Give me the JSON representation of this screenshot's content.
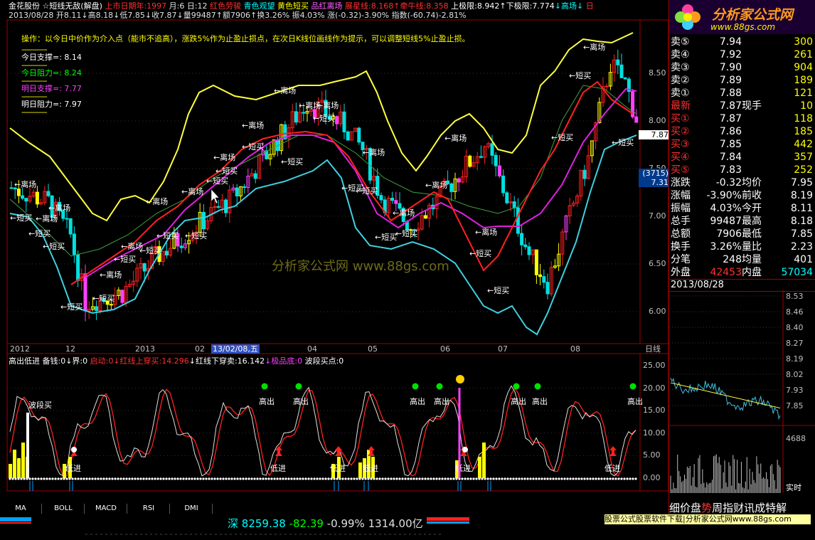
{
  "header": {
    "line1": [
      {
        "text": "金花股份",
        "color": "#ffffff"
      },
      {
        "text": " ☆短线无敌(解盘)",
        "color": "#ffffff"
      },
      {
        "text": " 上市日期年:1997",
        "color": "#ff3030"
      },
      {
        "text": " 月:6",
        "color": "#e0e0e0"
      },
      {
        "text": " 日:12",
        "color": "#e0e0e0"
      },
      {
        "text": " 红色劳骏",
        "color": "#ff3030"
      },
      {
        "text": " 青色观望",
        "color": "#00ffff"
      },
      {
        "text": " 黄色短买",
        "color": "#ffff00"
      },
      {
        "text": " 品红离场",
        "color": "#ff60ff"
      },
      {
        "text": " 展星线:8.168",
        "color": "#ff3030"
      },
      {
        "text": "↑牵牛线:8.358",
        "color": "#ff3030"
      },
      {
        "text": " 上极限:8.942",
        "color": "#ffffff"
      },
      {
        "text": "↑下极限:7.774",
        "color": "#ffffff"
      },
      {
        "text": "↓高场↓",
        "color": "#00ffff"
      },
      {
        "text": " 日",
        "color": "#ff3030"
      }
    ],
    "line2": [
      {
        "text": "2013/08/28",
        "color": "#e0e0e0"
      },
      {
        "text": " 开8.11↓",
        "color": "#e0e0e0"
      },
      {
        "text": "高8.18↓",
        "color": "#e0e0e0"
      },
      {
        "text": "低7.85↓",
        "color": "#e0e0e0"
      },
      {
        "text": "收7.87↓",
        "color": "#e0e0e0"
      },
      {
        "text": "量99487↑",
        "color": "#e0e0e0"
      },
      {
        "text": "额7906↑",
        "color": "#e0e0e0"
      },
      {
        "text": "换3.26%",
        "color": "#e0e0e0"
      },
      {
        "text": " 振4.03%",
        "color": "#e0e0e0"
      },
      {
        "text": " 涨(-0.32)-3.90%",
        "color": "#e0e0e0"
      },
      {
        "text": " 指数(-60.74)-2.81%",
        "color": "#e0e0e0"
      }
    ]
  },
  "tip": "操作：以今日中价作为介入点（能市不追高），涨跌5%作为止盈止损点，在次日K线位画线作为提示，可以调整短线5%止盈止损。",
  "support_resistance": [
    {
      "label": "今日支撑=:",
      "value": "8.14",
      "color": "#ffffff"
    },
    {
      "label": "今日阻力=:",
      "value": "8.24",
      "color": "#00ff00"
    },
    {
      "label": "明日支撑=:",
      "value": "7.77",
      "color": "#ff40ff"
    },
    {
      "label": "明日阻力=:",
      "value": "7.97",
      "color": "#ffffff"
    }
  ],
  "sr_dash": "------------",
  "price_axis": [
    "8.50",
    "8.00",
    "7.50",
    "7.00",
    "6.50",
    "6.00"
  ],
  "price_tags": {
    "current": "7.87",
    "code": "(3715)",
    "low": "7.31"
  },
  "watermark": "分析家公式网 www.88gs.com",
  "date_axis": [
    {
      "text": "2012"
    },
    {
      "text": "12"
    },
    {
      "text": "2013"
    },
    {
      "text": "02"
    },
    {
      "text": "13/02/08,五",
      "highlight": true
    },
    {
      "text": "04"
    },
    {
      "text": "05"
    },
    {
      "text": "06"
    },
    {
      "text": "07"
    },
    {
      "text": "08"
    },
    {
      "text": "日线"
    }
  ],
  "main_labels": {
    "leave": "离场",
    "buy": "短买"
  },
  "indicator": {
    "header": [
      {
        "text": "高出低进",
        "color": "#ffffff"
      },
      {
        "text": "  备钱:0",
        "color": "#ffffff"
      },
      {
        "text": "↓界:0",
        "color": "#ffffff"
      },
      {
        "text": "  启动:0",
        "color": "#ff3030"
      },
      {
        "text": "↓红线上穿买:14.296",
        "color": "#ff3030"
      },
      {
        "text": "↓红线下穿卖:16.142",
        "color": "#ffffff"
      },
      {
        "text": "↓极品底:0",
        "color": "#ff40ff"
      },
      {
        "text": "  波段买点:0",
        "color": "#ffffff"
      }
    ],
    "axis": [
      "25.00",
      "20.00",
      "15.00",
      "10.00",
      "5.00",
      "0.00"
    ],
    "labels": {
      "high_out": "高出",
      "low_in": "低进",
      "wave_buy": "波段买"
    }
  },
  "tabs": [
    "MA",
    "BOLL",
    "MACD",
    "RSI",
    "DMI"
  ],
  "quote": {
    "asks": [
      {
        "label": "卖⑤",
        "price": "7.94",
        "vol": "300"
      },
      {
        "label": "卖④",
        "price": "7.92",
        "vol": "261"
      },
      {
        "label": "卖③",
        "price": "7.90",
        "vol": "904"
      },
      {
        "label": "卖②",
        "price": "7.89",
        "vol": "189"
      },
      {
        "label": "卖①",
        "price": "7.88",
        "vol": "121"
      }
    ],
    "latest": {
      "label": "最新",
      "price": "7.87",
      "extra": "现手",
      "vol": "10"
    },
    "bids": [
      {
        "label": "买①",
        "price": "7.87",
        "vol": "118"
      },
      {
        "label": "买②",
        "price": "7.86",
        "vol": "185"
      },
      {
        "label": "买③",
        "price": "7.85",
        "vol": "442"
      },
      {
        "label": "买④",
        "price": "7.84",
        "vol": "357"
      },
      {
        "label": "买⑤",
        "price": "7.83",
        "vol": "252"
      }
    ],
    "stats": [
      {
        "l1": "涨跌",
        "v1": "-0.32",
        "l2": "均价",
        "v2": "7.95"
      },
      {
        "l1": "涨幅",
        "v1": "-3.90%",
        "l2": "前收",
        "v2": "8.19"
      },
      {
        "l1": "振幅",
        "v1": "4.03%",
        "l2": "今开",
        "v2": "8.11"
      },
      {
        "l1": "总手",
        "v1": "99487",
        "l2": "最高",
        "v2": "8.18"
      },
      {
        "l1": "总额",
        "v1": "7906",
        "l2": "最低",
        "v2": "7.85"
      },
      {
        "l1": "换手",
        "v1": "3.26%",
        "l2": "量比",
        "v2": "2.23"
      },
      {
        "l1": "分笔",
        "v1": "248",
        "l2": "均量",
        "v2": "401"
      }
    ],
    "outer": {
      "l1": "外盘",
      "v1": "42453",
      "l2": "内盘",
      "v2": "57034"
    }
  },
  "intraday": {
    "date": "2013/08/28",
    "axis": [
      "8.53",
      "8.46",
      "8.40",
      "8.27",
      "8.19",
      "8.02",
      "7.93",
      "7.85"
    ],
    "vol_label": "4688",
    "realtime": "实时"
  },
  "logo": {
    "title": "分析家公式网",
    "url": "www.88gs.com"
  },
  "right_tabs": [
    "细",
    "价",
    "盘",
    "势",
    "周",
    "指",
    "财",
    "讯",
    "成",
    "特",
    "解"
  ],
  "index_bar": {
    "name": "深",
    "value": "8259.38",
    "change": "-82.39",
    "pct": "-0.99%",
    "amount": "1314.00亿"
  },
  "ad": "股票公式股票软件下载|分析家公式网www.88gs.com"
}
